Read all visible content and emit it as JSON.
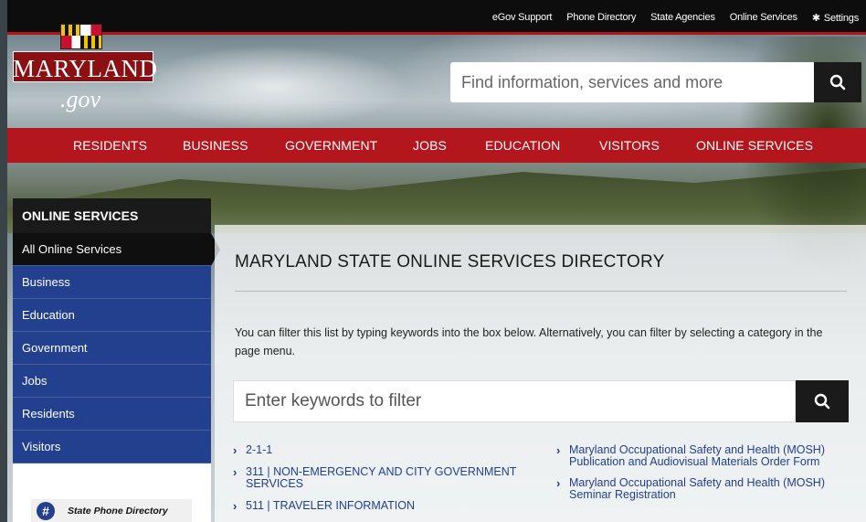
{
  "topbar": {
    "links": [
      "eGov Support",
      "Phone Directory",
      "State Agencies",
      "Online Services",
      "Settings"
    ]
  },
  "logo": {
    "word": "MARYLAND",
    "gov": ".gov"
  },
  "search": {
    "placeholder": "Find information, services and more"
  },
  "nav": {
    "items": [
      "RESIDENTS",
      "BUSINESS",
      "GOVERNMENT",
      "JOBS",
      "EDUCATION",
      "VISITORS",
      "ONLINE SERVICES"
    ]
  },
  "sidebar": {
    "header": "ONLINE SERVICES",
    "items": [
      "All Online Services",
      "Business",
      "Education",
      "Government",
      "Jobs",
      "Residents",
      "Visitors"
    ],
    "phone_directory": "State Phone Directory"
  },
  "main": {
    "title": "MARYLAND STATE ONLINE SERVICES DIRECTORY",
    "intro": "You can filter this list by typing keywords into the box below. Alternatively, you can filter by selecting a category in the page menu.",
    "filter_placeholder": "Enter keywords to filter",
    "left_services": [
      "2-1-1",
      "311 | NON-EMERGENCY AND CITY GOVERNMENT SERVICES",
      "511 | TRAVELER INFORMATION"
    ],
    "right_services": [
      "Maryland Occupational Safety and Health (MOSH) Publication and Audiovisual Materials Order Form",
      "Maryland Occupational Safety and Health (MOSH) Seminar Registration"
    ]
  },
  "icons": {
    "search": "search-icon",
    "settings": "gear-icon",
    "chevron": "chevron-right-icon",
    "phone": "hash-icon"
  }
}
